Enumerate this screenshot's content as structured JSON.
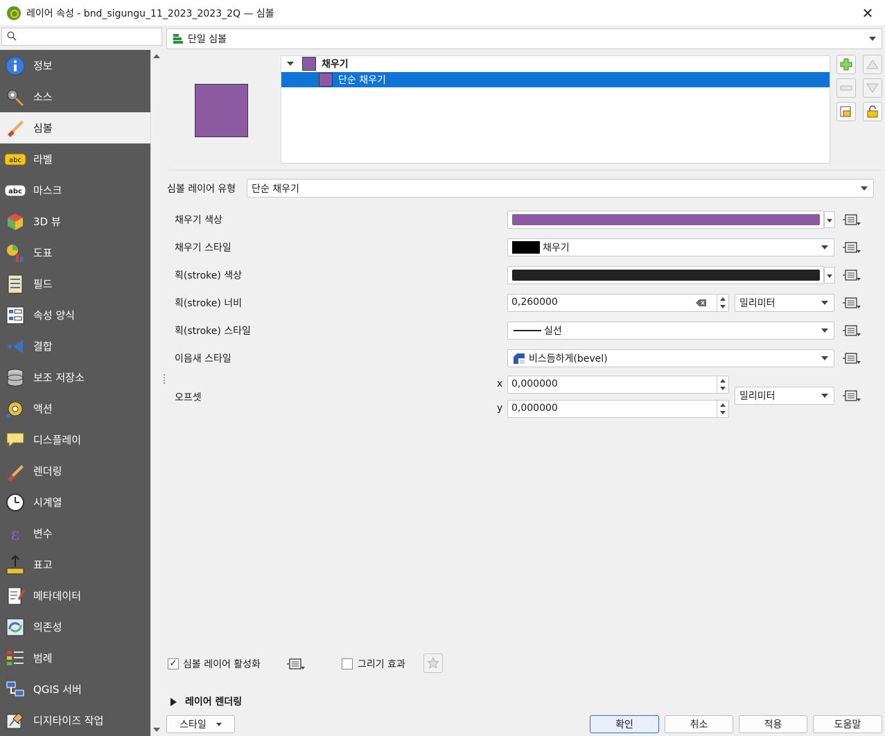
{
  "window": {
    "title": "레이어 속성 - bnd_sigungu_11_2023_2023_2Q — 심볼",
    "close": "✕"
  },
  "search": {
    "placeholder": ""
  },
  "sidebar": {
    "items": [
      {
        "label": "정보",
        "icon": "info-icon"
      },
      {
        "label": "소스",
        "icon": "source-icon"
      },
      {
        "label": "심볼",
        "icon": "symbology-icon",
        "active": true
      },
      {
        "label": "라벨",
        "icon": "labels-icon"
      },
      {
        "label": "마스크",
        "icon": "mask-icon"
      },
      {
        "label": "3D 뷰",
        "icon": "3d-view-icon"
      },
      {
        "label": "도표",
        "icon": "diagram-icon"
      },
      {
        "label": "필드",
        "icon": "fields-icon"
      },
      {
        "label": "속성 양식",
        "icon": "attribute-form-icon"
      },
      {
        "label": "결합",
        "icon": "joins-icon"
      },
      {
        "label": "보조 저장소",
        "icon": "auxiliary-storage-icon"
      },
      {
        "label": "액션",
        "icon": "actions-icon"
      },
      {
        "label": "디스플레이",
        "icon": "display-icon"
      },
      {
        "label": "렌더링",
        "icon": "rendering-icon"
      },
      {
        "label": "시계열",
        "icon": "temporal-icon"
      },
      {
        "label": "변수",
        "icon": "variables-icon"
      },
      {
        "label": "표고",
        "icon": "elevation-icon"
      },
      {
        "label": "메타데이터",
        "icon": "metadata-icon"
      },
      {
        "label": "의존성",
        "icon": "dependencies-icon"
      },
      {
        "label": "범례",
        "icon": "legend-icon"
      },
      {
        "label": "QGIS 서버",
        "icon": "qgis-server-icon"
      },
      {
        "label": "디지타이즈 작업",
        "icon": "digitizing-icon"
      }
    ]
  },
  "renderer": {
    "value": "단일 심볼"
  },
  "symbol_tree": {
    "root": "채우기",
    "child": "단순 채우기"
  },
  "symbol_layer_type": {
    "label": "심볼 레이어 유형",
    "value": "단순 채우기"
  },
  "props": {
    "fill_color": {
      "label": "채우기 색상",
      "color": "#8c5aa0"
    },
    "fill_style": {
      "label": "채우기 스타일",
      "value": "채우기"
    },
    "stroke_color": {
      "label": "획(stroke) 색상",
      "color": "#232323"
    },
    "stroke_width": {
      "label": "획(stroke) 너비",
      "value": "0,260000",
      "unit": "밀리미터"
    },
    "stroke_style": {
      "label": "획(stroke) 스타일",
      "value": "실선"
    },
    "join_style": {
      "label": "이음새 스타일",
      "value": "비스듬하게(bevel)"
    },
    "offset": {
      "label": "오프셋",
      "x_label": "x",
      "y_label": "y",
      "x": "0,000000",
      "y": "0,000000",
      "unit": "밀리미터"
    }
  },
  "bottom": {
    "enable_layer": "심볼 레이어 활성화",
    "draw_effects": "그리기 효과",
    "layer_rendering": "레이어 렌더링",
    "style_btn": "스타일",
    "ok": "확인",
    "cancel": "취소",
    "apply": "적용",
    "help": "도움말"
  },
  "colors": {
    "accent_selection": "#0f74d6",
    "sidebar_bg": "#595959",
    "symbol_fill": "#8c5aa0"
  }
}
